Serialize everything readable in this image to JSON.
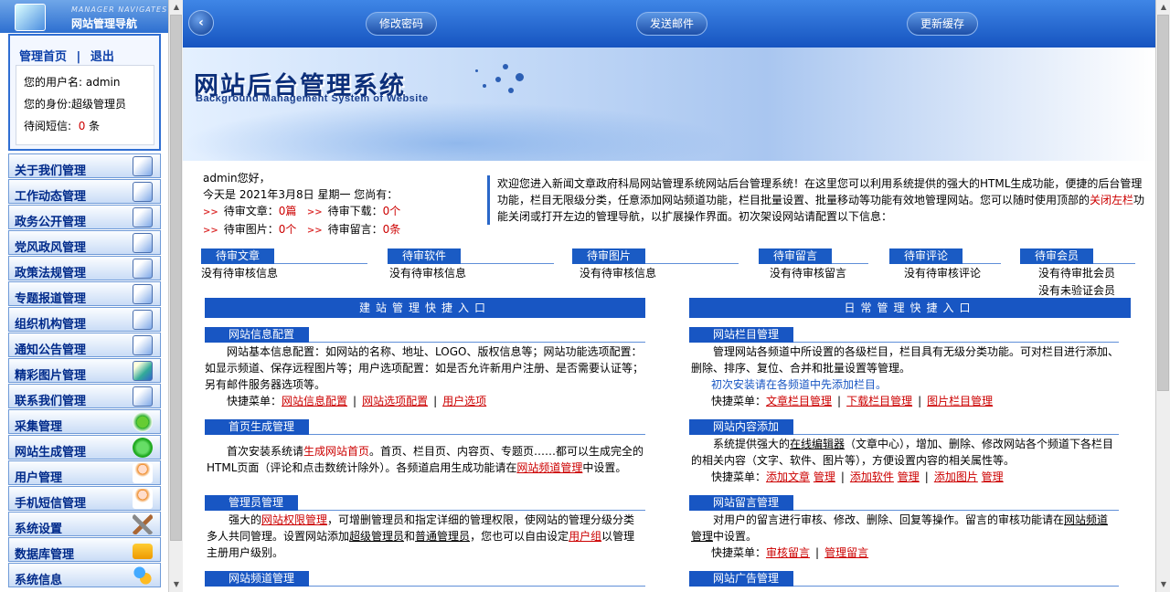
{
  "nav": {
    "logo_en": "MANAGER NAVIGATES",
    "logo_cn": "网站管理导航",
    "home_link": "管理首页",
    "separator": "|",
    "logout_link": "退出",
    "username_label": "您的用户名:",
    "username": "admin",
    "role_label": "您的身份:",
    "role": "超级管理员",
    "sms_label": "待阅短信:",
    "sms_count": "0",
    "sms_unit": "条",
    "menu": [
      {
        "label": "关于我们管理",
        "icon": "note-edit-icon"
      },
      {
        "label": "工作动态管理",
        "icon": "note-edit-icon"
      },
      {
        "label": "政务公开管理",
        "icon": "note-edit-icon"
      },
      {
        "label": "党风政风管理",
        "icon": "note-edit-icon"
      },
      {
        "label": "政策法规管理",
        "icon": "note-edit-icon"
      },
      {
        "label": "专题报道管理",
        "icon": "note-edit-icon"
      },
      {
        "label": "组织机构管理",
        "icon": "note-edit-icon"
      },
      {
        "label": "通知公告管理",
        "icon": "note-edit-icon"
      },
      {
        "label": "精彩图片管理",
        "icon": "picture-icon"
      },
      {
        "label": "联系我们管理",
        "icon": "note-edit-icon"
      },
      {
        "label": "采集管理",
        "icon": "recycle-icon"
      },
      {
        "label": "网站生成管理",
        "icon": "play-icon"
      },
      {
        "label": "用户管理",
        "icon": "user-icon"
      },
      {
        "label": "手机短信管理",
        "icon": "user-icon"
      },
      {
        "label": "系统设置",
        "icon": "tools-icon"
      },
      {
        "label": "数据库管理",
        "icon": "lock-icon"
      },
      {
        "label": "系统信息",
        "icon": "gears-icon"
      }
    ]
  },
  "toolbar": {
    "back_glyph": "‹",
    "btn_password": "修改密码",
    "btn_mail": "发送邮件",
    "btn_cache": "更新缓存"
  },
  "banner": {
    "title": "网站后台管理系统",
    "subtitle": "Background Management System of Website"
  },
  "welcome": {
    "greeting": "admin您好，",
    "today": "今天是 2021年3月8日 星期一 您尚有：",
    "arrow": ">>",
    "items": [
      {
        "label": "待审文章：",
        "value": "0篇"
      },
      {
        "label": "待审下载：",
        "value": "0个"
      },
      {
        "label": "待审图片：",
        "value": "0个"
      },
      {
        "label": "待审留言：",
        "value": "0条"
      }
    ]
  },
  "intro": {
    "text1": "欢迎您进入新闻文章政府科局网站管理系统网站后台管理系统！在这里您可以利用系统提供的强大的HTML生成功能，便捷的后台管理功能，栏目无限级分类，任意添加网站频道功能，栏目批量设置、批量移动等功能有效地管理网站。您可以随时使用顶部的",
    "highlight": "关闭左栏",
    "text2": "功能关闭或打开左边的管理导航，以扩展操作界面。初次架设网站请配置以下信息："
  },
  "pending": [
    {
      "tab": "待审文章",
      "text": "没有待审核信息"
    },
    {
      "tab": "待审软件",
      "text": "没有待审核信息"
    },
    {
      "tab": "待审图片",
      "text": "没有待审核信息"
    },
    {
      "tab": "待审留言",
      "text": "没有待审核留言"
    },
    {
      "tab": "待审评论",
      "text": "没有待审核评论"
    },
    {
      "tab": "待审会员",
      "text": "没有待审批会员",
      "text2": "没有未验证会员"
    }
  ],
  "sections": {
    "left_title": "建站管理快捷入口",
    "right_title": "日常管理快捷入口"
  },
  "blocks": {
    "site_info": {
      "title": "网站信息配置",
      "desc": "网站基本信息配置：如网站的名称、地址、LOGO、版权信息等；网站功能选项配置：如显示频道、保存远程图片等；用户选项配置：如是否允许新用户注册、是否需要认证等；另有邮件服务器选项等。",
      "menu_label": "快捷菜单：",
      "links": [
        "网站信息配置",
        "网站选项配置",
        "用户选项"
      ]
    },
    "home_gen": {
      "title": "首页生成管理",
      "desc1": "首次安装系统请",
      "link1": "生成网站首页",
      "desc2": "。首页、栏目页、内容页、专题页……都可以生成完全的HTML页面（评论和点击数统计除外）。各频道启用生成功能请在",
      "link2": "网站频道管理",
      "desc3": "中设置。"
    },
    "admin_mgmt": {
      "title": "管理员管理",
      "desc1": "强大的",
      "link1": "网站权限管理",
      "desc2": "，可增删管理员和指定详细的管理权限，使网站的管理分级分类多人共同管理。设置网站添加",
      "u1": "超级管理员",
      "desc3": "和",
      "u2": "普通管理员",
      "desc4": "，您也可以自由设定",
      "link2": "用户组",
      "desc5": "以管理主册用户级别。"
    },
    "channel_mgmt": {
      "title": "网站频道管理"
    },
    "column_mgmt": {
      "title": "网站栏目管理",
      "desc": "管理网站各频道中所设置的各级栏目，栏目具有无级分类功能。可对栏目进行添加、删除、排序、复位、合并和批量设置等管理。",
      "note": "初次安装请在各频道中先添加栏目。",
      "menu_label": "快捷菜单：",
      "links": [
        "文章栏目管理",
        "下载栏目管理",
        "图片栏目管理"
      ]
    },
    "content_add": {
      "title": "网站内容添加",
      "desc1": "系统提供强大的",
      "u1": "在线编辑器",
      "desc2": "（文章中心），增加、删除、修改网站各个频道下各栏目的相关内容（文字、软件、图片等），方便设置内容的相关属性等。",
      "menu_label": "快捷菜单：",
      "links": [
        "添加文章",
        "管理",
        "添加软件",
        "管理",
        "添加图片",
        "管理"
      ]
    },
    "msg_mgmt": {
      "title": "网站留言管理",
      "desc1": "对用户的留言进行审核、修改、删除、回复等操作。留言的审核功能请在",
      "u1": "网站频道管理",
      "desc2": "中设置。",
      "menu_label": "快捷菜单：",
      "links": [
        "审核留言",
        "管理留言"
      ]
    },
    "ad_mgmt": {
      "title": "网站广告管理"
    }
  }
}
